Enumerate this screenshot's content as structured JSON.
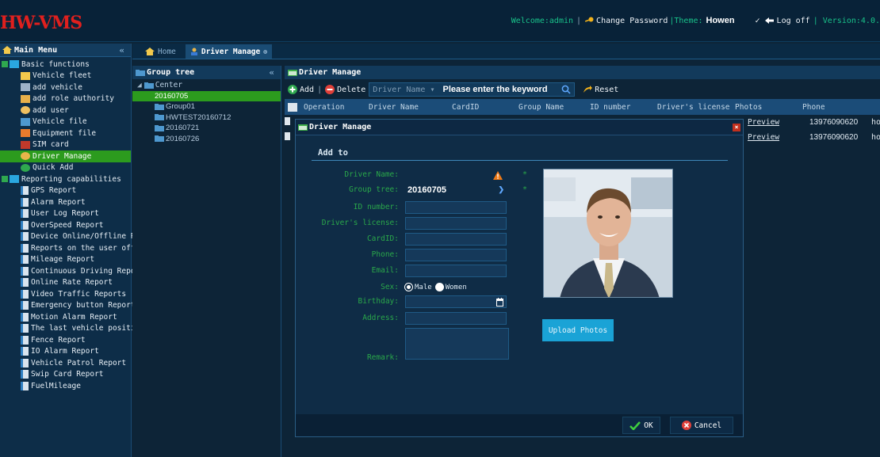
{
  "app": {
    "logo": "HW-VMS",
    "welcome": "Welcome:admin",
    "change_password": "Change Password",
    "theme_label": "|Theme:",
    "theme_value": "Howen",
    "log_off": "Log off",
    "version": "| Version:4.0."
  },
  "left": {
    "title": "Main Menu",
    "items": [
      {
        "label": "Basic functions",
        "level": 0,
        "icon": "folder-icon"
      },
      {
        "label": "Vehicle fleet",
        "level": 1,
        "icon": "fleet-icon"
      },
      {
        "label": "add vehicle",
        "level": 1,
        "icon": "car-icon"
      },
      {
        "label": "add role authority",
        "level": 1,
        "icon": "role-icon"
      },
      {
        "label": "add user",
        "level": 1,
        "icon": "user-icon"
      },
      {
        "label": "Vehicle file",
        "level": 1,
        "icon": "file-icon"
      },
      {
        "label": "Equipment file",
        "level": 1,
        "icon": "equipment-icon"
      },
      {
        "label": "SIM card",
        "level": 1,
        "icon": "sim-icon"
      },
      {
        "label": "Driver Manage",
        "level": 1,
        "icon": "driver-icon",
        "selected": true
      },
      {
        "label": "Quick Add",
        "level": 1,
        "icon": "plus-icon"
      },
      {
        "label": "Reporting capabilities",
        "level": 0,
        "icon": "folder-icon"
      },
      {
        "label": "GPS Report",
        "level": 1,
        "icon": "report-icon"
      },
      {
        "label": "Alarm Report",
        "level": 1,
        "icon": "report-icon"
      },
      {
        "label": "User Log Report",
        "level": 1,
        "icon": "report-icon"
      },
      {
        "label": "OverSpeed Report",
        "level": 1,
        "icon": "report-icon"
      },
      {
        "label": "Device Online/Offline R",
        "level": 1,
        "icon": "report-icon"
      },
      {
        "label": "Reports on the user off",
        "level": 1,
        "icon": "report-icon"
      },
      {
        "label": "Mileage Report",
        "level": 1,
        "icon": "report-icon"
      },
      {
        "label": "Continuous Driving Repo",
        "level": 1,
        "icon": "report-icon"
      },
      {
        "label": "Online Rate Report",
        "level": 1,
        "icon": "report-icon"
      },
      {
        "label": "Video Traffic Reports",
        "level": 1,
        "icon": "report-icon"
      },
      {
        "label": "Emergency button Report",
        "level": 1,
        "icon": "report-icon"
      },
      {
        "label": "Motion Alarm Report",
        "level": 1,
        "icon": "report-icon"
      },
      {
        "label": "The last vehicle positi",
        "level": 1,
        "icon": "report-icon"
      },
      {
        "label": "Fence Report",
        "level": 1,
        "icon": "report-icon"
      },
      {
        "label": "IO Alarm Report",
        "level": 1,
        "icon": "report-icon"
      },
      {
        "label": "Vehicle Patrol Report",
        "level": 1,
        "icon": "report-icon"
      },
      {
        "label": "Swip Card Report",
        "level": 1,
        "icon": "report-icon"
      },
      {
        "label": "FuelMileage",
        "level": 1,
        "icon": "report-icon"
      }
    ]
  },
  "tabs": {
    "home": "Home",
    "driver": "Driver Manage"
  },
  "group_tree": {
    "title": "Group tree",
    "root": "Center",
    "nodes": [
      "20160705",
      "Group01",
      "HWTEST20160712",
      "20160721",
      "20160726"
    ]
  },
  "driver_panel": {
    "title": "Driver Manage",
    "add": "Add",
    "delete": "Delete",
    "search_field": "Driver Name",
    "search_placeholder": "Please enter the keyword",
    "reset": "Reset",
    "columns": [
      "Operation",
      "Driver Name",
      "CardID",
      "Group Name",
      "ID number",
      "Driver's license",
      "Photos",
      "Phone"
    ],
    "rows": [
      {
        "photos": "Preview",
        "phone": "13976090620",
        "extra": "ho"
      },
      {
        "photos": "Preview",
        "phone": "13976090620",
        "extra": "ho"
      }
    ]
  },
  "modal": {
    "title": "Driver Manage",
    "section": "Add to",
    "labels": {
      "driver_name": "Driver Name:",
      "group_tree": "Group tree:",
      "id_number": "ID number:",
      "license": "Driver's license:",
      "cardid": "CardID:",
      "phone": "Phone:",
      "email": "Email:",
      "sex": "Sex:",
      "birthday": "Birthday:",
      "address": "Address:",
      "remark": "Remark:"
    },
    "group_value": "20160705",
    "star": "*",
    "sex_male": "Male",
    "sex_women": "Women",
    "upload": "Upload Photos",
    "ok": "OK",
    "cancel": "Cancel"
  }
}
